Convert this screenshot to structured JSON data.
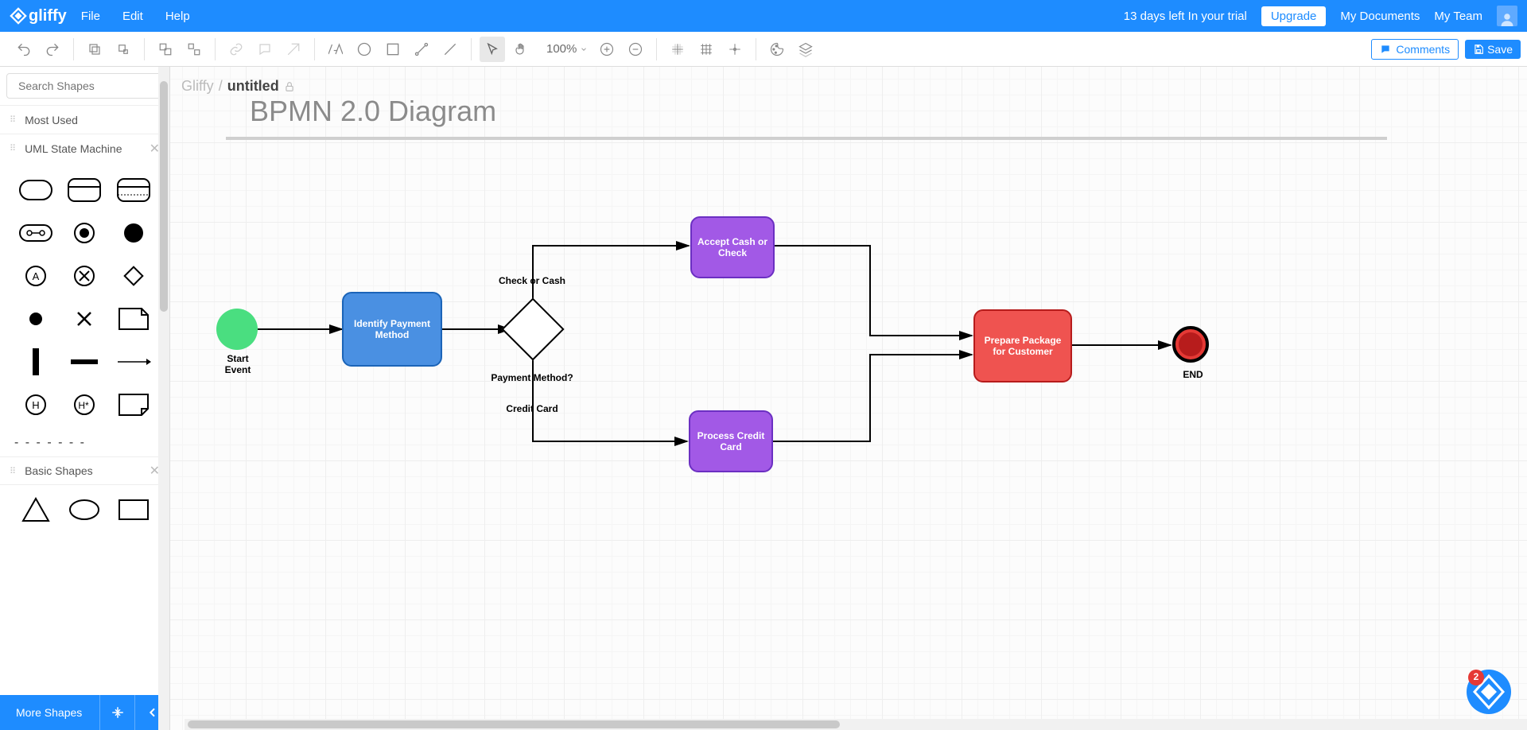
{
  "header": {
    "brand": "gliffy",
    "menu": {
      "file": "File",
      "edit": "Edit",
      "help": "Help"
    },
    "trial_text": "13 days left In your trial",
    "upgrade": "Upgrade",
    "my_documents": "My Documents",
    "my_team": "My Team"
  },
  "toolbar": {
    "zoom": "100%",
    "comments": "Comments",
    "save": "Save"
  },
  "breadcrumb": {
    "root": "Gliffy",
    "sep": "/",
    "doc": "untitled"
  },
  "sidebar": {
    "search_placeholder": "Search Shapes",
    "cat_mostused": "Most Used",
    "cat_uml": "UML State Machine",
    "cat_basic": "Basic Shapes",
    "more_shapes": "More Shapes"
  },
  "diagram": {
    "title": "BPMN 2.0 Diagram",
    "start_label": "Start\nEvent",
    "identify": "Identify Payment Method",
    "check_cash_label": "Check or Cash",
    "payment_method_label": "Payment Method?",
    "credit_label": "Credit Card",
    "accept_cash": "Accept Cash or Check",
    "process_credit": "Process Credit Card",
    "prepare_package": "Prepare Package for Customer",
    "end_label": "END"
  },
  "badge_count": "2"
}
